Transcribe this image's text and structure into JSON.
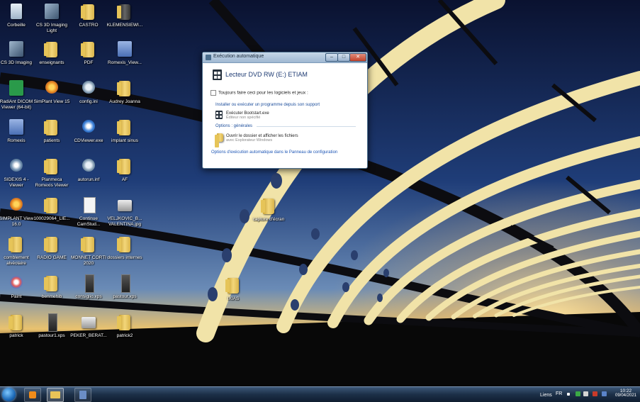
{
  "desktop_icons": [
    {
      "label": "Corbeille",
      "icon": "recycle-bin-icon"
    },
    {
      "label": "CS 3D Imaging Light",
      "icon": "cs-3d-imaging-icon"
    },
    {
      "label": "CASTRO",
      "icon": "folder-icon"
    },
    {
      "label": "KLEMENSIEWI...",
      "icon": "folder-dark-icon"
    },
    {
      "label": "CS 3D Imaging",
      "icon": "cs-3d-imaging-icon"
    },
    {
      "label": "enseignants",
      "icon": "folder-icon"
    },
    {
      "label": "PDF",
      "icon": "folder-icon"
    },
    {
      "label": "Romexis_View...",
      "icon": "romexis-icon"
    },
    {
      "label": "RadiAnt DICOM Viewer (64-bit)",
      "icon": "radiant-icon"
    },
    {
      "label": "SimPlant View 15",
      "icon": "simplant-icon"
    },
    {
      "label": "config.ini",
      "icon": "config-file-icon"
    },
    {
      "label": "Audrey Joanna",
      "icon": "folder-icon"
    },
    {
      "label": "Romexis",
      "icon": "romexis-icon"
    },
    {
      "label": "patients",
      "icon": "folder-icon"
    },
    {
      "label": "CDViewer.exe",
      "icon": "cdviewer-icon"
    },
    {
      "label": "implant sinus",
      "icon": "folder-icon"
    },
    {
      "label": "SIDEXIS 4 - Viewer",
      "icon": "sidexis-icon"
    },
    {
      "label": "Planmeca Romexis Viewer",
      "icon": "folder-icon"
    },
    {
      "label": "autorun.inf",
      "icon": "config-file-icon"
    },
    {
      "label": "AF",
      "icon": "folder-icon"
    },
    {
      "label": "SIMPLANT View 16.0",
      "icon": "simplant-icon"
    },
    {
      "label": "100029064_LIE...",
      "icon": "folder-icon"
    },
    {
      "label": "Continue CamStud...",
      "icon": "document-icon"
    },
    {
      "label": "VELJKOVIC_B... VALENTINA.jpg",
      "icon": "image-file-icon"
    },
    {
      "label": "comblement alvéolaire",
      "icon": "folder-icon"
    },
    {
      "label": "RADIO GAME",
      "icon": "folder-icon"
    },
    {
      "label": "MONNET CORTI 2020",
      "icon": "folder-icon"
    },
    {
      "label": "dossiers internes",
      "icon": "folder-icon"
    },
    {
      "label": "Paint",
      "icon": "paint-icon"
    },
    {
      "label": "benmehib",
      "icon": "folder-icon"
    },
    {
      "label": "consiglio.xps",
      "icon": "xps-file-icon"
    },
    {
      "label": "pastour.xps",
      "icon": "xps-file-icon"
    },
    {
      "label": "patrick",
      "icon": "folder-icon"
    },
    {
      "label": "pastour1.xps",
      "icon": "xps-file-icon"
    },
    {
      "label": "PEKER_BERAT...",
      "icon": "image-file-icon"
    },
    {
      "label": "patrick2",
      "icon": "folder-icon"
    }
  ],
  "floating_icons": [
    {
      "label": "capture d'écran",
      "icon": "folder-icon"
    },
    {
      "label": "IXIAS",
      "icon": "folder-icon"
    }
  ],
  "dialog": {
    "title": "Exécution automatique",
    "device": "Lecteur DVD RW (E:) ETIAM",
    "always_checkbox": "Toujours faire ceci pour les logiciels et jeux :",
    "section_install": "Installer ou exécuter un programme depuis son support",
    "run_option": "Exécuter Bootstart.exe",
    "run_publisher": "Éditeur non spécifié",
    "section_general": "Options : générales",
    "open_folder": "Ouvrir le dossier et afficher les fichiers",
    "open_folder_sub": "avec Explorateur Windows",
    "config_link": "Options d'exécution automatique dans le Panneau de configuration",
    "min_symbol": "–",
    "max_symbol": "□",
    "close_symbol": "✕"
  },
  "taskbar": {
    "links_label": "Liens",
    "language": "FR",
    "time": "10:22",
    "date": "09/04/2021"
  },
  "colors": {
    "sky_top": "#0a1026",
    "sky_glow": "#e8c070",
    "structure": "#f2e6b0",
    "link": "#1c55b5"
  }
}
